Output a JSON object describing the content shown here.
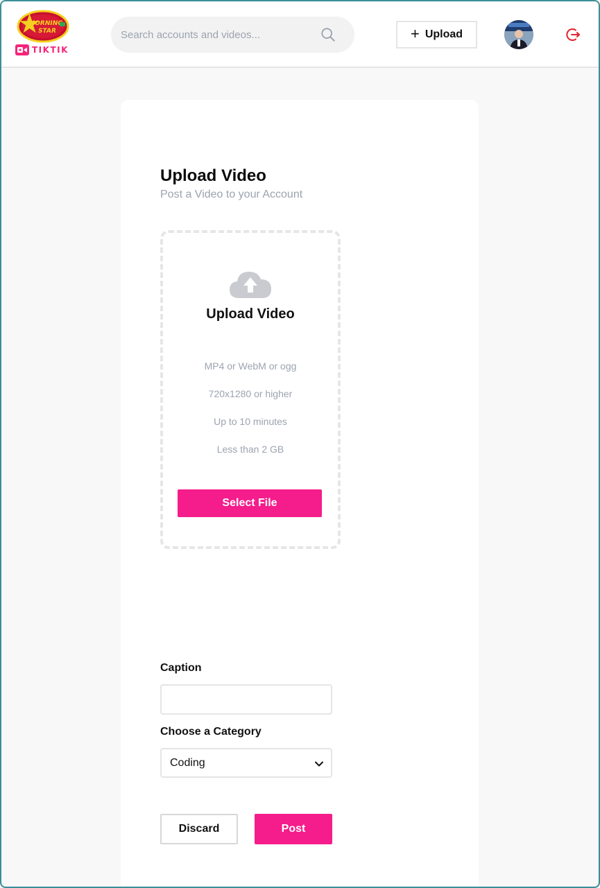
{
  "header": {
    "logo_alt": "MORNING STAR",
    "brand_text": "TIKTIK",
    "search": {
      "placeholder": "Search accounts and videos...",
      "value": ""
    },
    "upload_label": "Upload"
  },
  "upload": {
    "title": "Upload Video",
    "subtitle": "Post a Video to your Account",
    "dropzone": {
      "title": "Upload Video",
      "info": [
        "MP4 or WebM or ogg",
        "720x1280 or higher",
        "Up to 10 minutes",
        "Less than 2 GB"
      ],
      "button_label": "Select File"
    }
  },
  "form": {
    "caption_label": "Caption",
    "caption_value": "",
    "category_label": "Choose a Category",
    "category_value": "Coding",
    "discard_label": "Discard",
    "post_label": "Post"
  },
  "colors": {
    "accent": "#f51c8c",
    "logo_red": "#c8102e",
    "logo_yellow": "#f5d020",
    "logout": "#e0242b"
  },
  "icons": {
    "search": "search-icon",
    "upload": "plus-icon",
    "cloud": "cloud-upload-icon",
    "logout": "logout-icon",
    "select": "chevron-down-icon"
  }
}
